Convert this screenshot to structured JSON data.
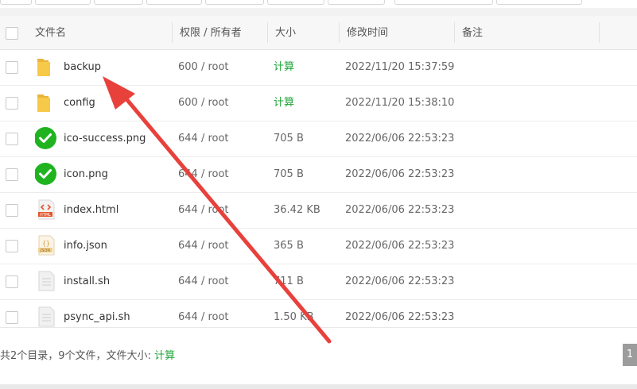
{
  "table": {
    "headers": {
      "name": "文件名",
      "perm": "权限 / 所有者",
      "size": "大小",
      "mtime": "修改时间",
      "note": "备注"
    },
    "rows": [
      {
        "name": "backup",
        "perm": "600 / root",
        "size": "计算",
        "mtime": "2022/11/20 15:37:59",
        "icon": "folder-icon"
      },
      {
        "name": "config",
        "perm": "600 / root",
        "size": "计算",
        "mtime": "2022/11/20 15:38:10",
        "icon": "folder-icon"
      },
      {
        "name": "ico-success.png",
        "perm": "644 / root",
        "size": "705 B",
        "mtime": "2022/06/06 22:53:23",
        "icon": "success-check-icon"
      },
      {
        "name": "icon.png",
        "perm": "644 / root",
        "size": "705 B",
        "mtime": "2022/06/06 22:53:23",
        "icon": "success-check-icon"
      },
      {
        "name": "index.html",
        "perm": "644 / root",
        "size": "36.42 KB",
        "mtime": "2022/06/06 22:53:23",
        "icon": "html-file-icon"
      },
      {
        "name": "info.json",
        "perm": "644 / root",
        "size": "365 B",
        "mtime": "2022/06/06 22:53:23",
        "icon": "json-file-icon"
      },
      {
        "name": "install.sh",
        "perm": "644 / root",
        "size": "711 B",
        "mtime": "2022/06/06 22:53:23",
        "icon": "text-file-icon"
      },
      {
        "name": "psync_api.sh",
        "perm": "644 / root",
        "size": "1.50 KB",
        "mtime": "2022/06/06 22:53:23",
        "icon": "text-file-icon"
      }
    ]
  },
  "footer": {
    "summary": "共2个目录，9个文件，文件大小:",
    "calc_link": "计算",
    "page": "1"
  },
  "colors": {
    "accent_green": "#20a53a",
    "arrow_red": "#e8413c",
    "folder_yellow": "#f7c948"
  },
  "html_icon_label": "HTML",
  "json_icon_label": "JSON"
}
